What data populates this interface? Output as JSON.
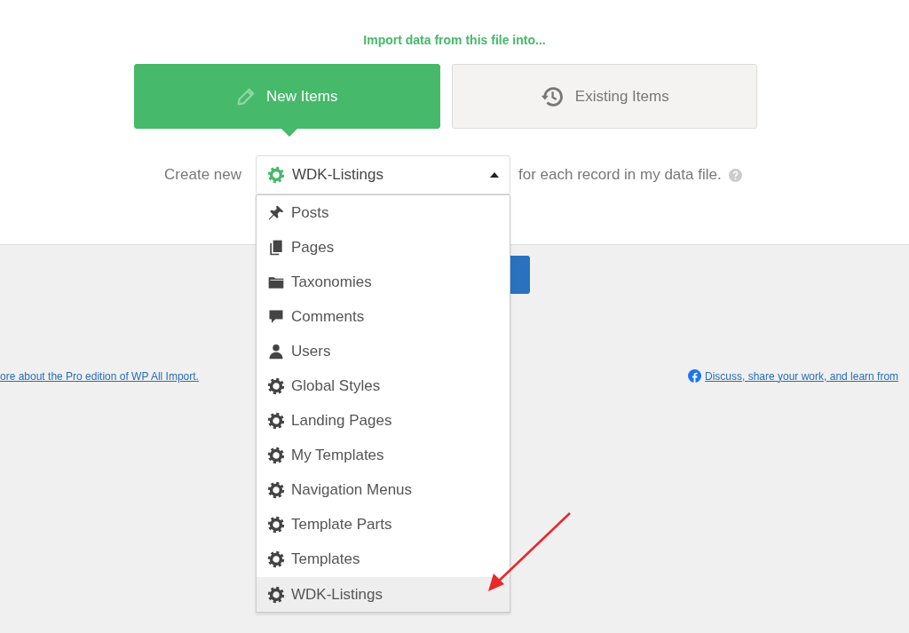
{
  "heading": "Import data from this file into...",
  "tabs": [
    {
      "label": "New Items",
      "kind": "new",
      "selected": true
    },
    {
      "label": "Existing Items",
      "kind": "existing",
      "selected": false
    }
  ],
  "create_label": "Create new",
  "select": {
    "value": "WDK-Listings",
    "expanded": true
  },
  "suffix": "for each record in my data file.",
  "options": [
    {
      "label": "Posts",
      "kind": "pin",
      "selected": false
    },
    {
      "label": "Pages",
      "kind": "pages",
      "selected": false
    },
    {
      "label": "Taxonomies",
      "kind": "folder",
      "selected": false
    },
    {
      "label": "Comments",
      "kind": "comment",
      "selected": false
    },
    {
      "label": "Users",
      "kind": "user",
      "selected": false
    },
    {
      "label": "Global Styles",
      "kind": "gear",
      "selected": false
    },
    {
      "label": "Landing Pages",
      "kind": "gear",
      "selected": false
    },
    {
      "label": "My Templates",
      "kind": "gear",
      "selected": false
    },
    {
      "label": "Navigation Menus",
      "kind": "gear",
      "selected": false
    },
    {
      "label": "Template Parts",
      "kind": "gear",
      "selected": false
    },
    {
      "label": "Templates",
      "kind": "gear",
      "selected": false
    },
    {
      "label": "WDK-Listings",
      "kind": "gear",
      "selected": true
    }
  ],
  "footer": {
    "left_link": "ore about the Pro edition of WP All Import.",
    "right_link": "Discuss, share your work, and learn from"
  }
}
